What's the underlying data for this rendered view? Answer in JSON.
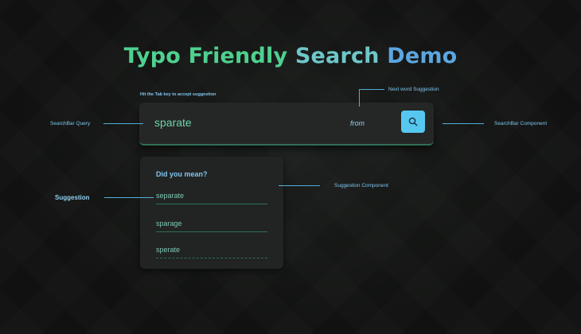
{
  "title": {
    "part1": "Typo Friendly",
    "part2": "Search",
    "part3": "Demo"
  },
  "hint": "Hit the Tab key to accept suggestion",
  "searchbar": {
    "query": "sparate",
    "next_word": "from",
    "search_icon": "search-icon"
  },
  "suggestions": {
    "heading": "Did you mean?",
    "items": [
      "separate",
      "sparage",
      "sperate"
    ]
  },
  "annotations": {
    "searchbar_query": "SearchBar Query",
    "next_word_suggestion": "Next word Suggestion",
    "searchbar_component": "SearchBar Component",
    "suggestion": "Suggestion",
    "suggestion_component": "Suggestion Component"
  },
  "colors": {
    "accent_green": "#4fd08e",
    "accent_blue": "#56c8f0",
    "panel": "#252726"
  }
}
